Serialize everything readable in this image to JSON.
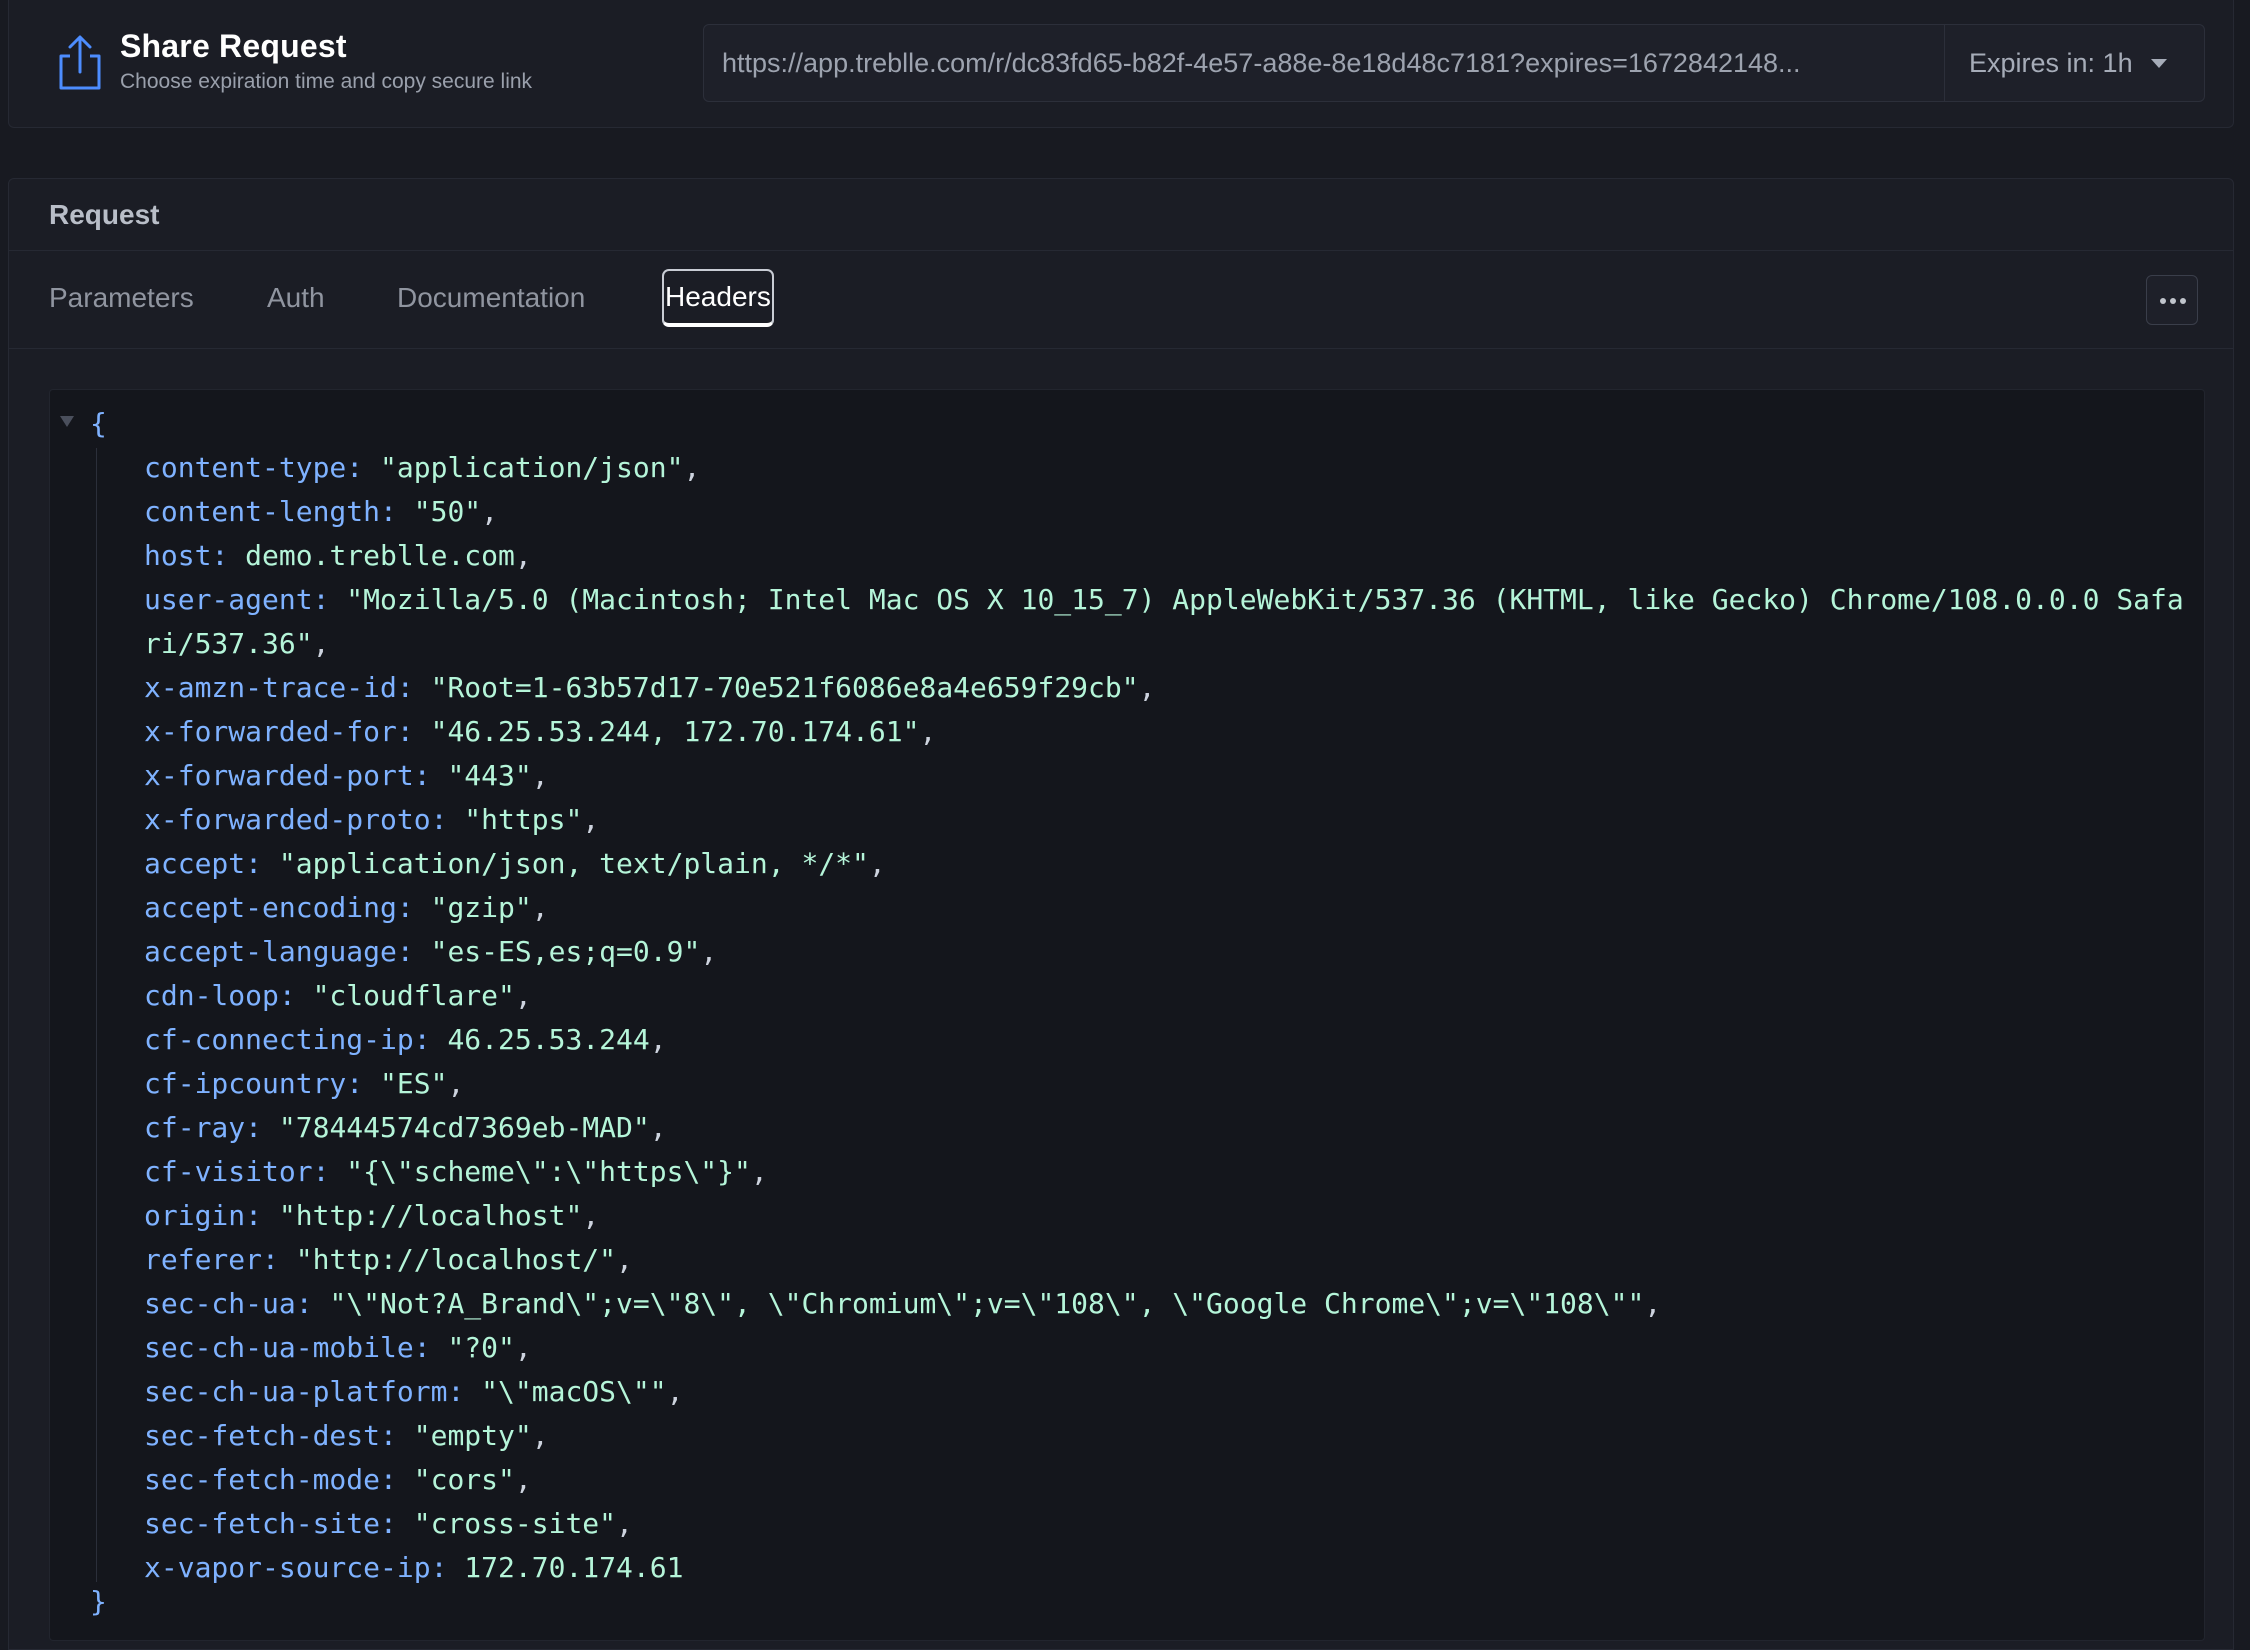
{
  "share": {
    "title": "Share Request",
    "subtitle": "Choose expiration time and copy secure link",
    "url": "https://app.treblle.com/r/dc83fd65-b82f-4e57-a88e-8e18d48c7181?expires=1672842148...",
    "expires_label": "Expires in: 1h",
    "icon": "share-upload-icon"
  },
  "request": {
    "title": "Request",
    "tabs": [
      {
        "label": "Parameters",
        "active": false
      },
      {
        "label": "Auth",
        "active": false
      },
      {
        "label": "Documentation",
        "active": false
      },
      {
        "label": "Headers",
        "active": true
      }
    ],
    "more_icon": "more-horizontal-icon"
  },
  "headers_json": {
    "open_brace": "{",
    "close_brace": "}",
    "entries": [
      {
        "key": "content-type",
        "value": "\"application/json\""
      },
      {
        "key": "content-length",
        "value": "\"50\""
      },
      {
        "key": "host",
        "value": "demo.treblle.com"
      },
      {
        "key": "user-agent",
        "value": "\"Mozilla/5.0 (Macintosh; Intel Mac OS X 10_15_7) AppleWebKit/537.36 (KHTML, like Gecko) Chrome/108.0.0.0 Safari/537.36\""
      },
      {
        "key": "x-amzn-trace-id",
        "value": "\"Root=1-63b57d17-70e521f6086e8a4e659f29cb\""
      },
      {
        "key": "x-forwarded-for",
        "value": "\"46.25.53.244, 172.70.174.61\""
      },
      {
        "key": "x-forwarded-port",
        "value": "\"443\""
      },
      {
        "key": "x-forwarded-proto",
        "value": "\"https\""
      },
      {
        "key": "accept",
        "value": "\"application/json, text/plain, */*\""
      },
      {
        "key": "accept-encoding",
        "value": "\"gzip\""
      },
      {
        "key": "accept-language",
        "value": "\"es-ES,es;q=0.9\""
      },
      {
        "key": "cdn-loop",
        "value": "\"cloudflare\""
      },
      {
        "key": "cf-connecting-ip",
        "value": "46.25.53.244"
      },
      {
        "key": "cf-ipcountry",
        "value": "\"ES\""
      },
      {
        "key": "cf-ray",
        "value": "\"78444574cd7369eb-MAD\""
      },
      {
        "key": "cf-visitor",
        "value": "\"{\\\"scheme\\\":\\\"https\\\"}\""
      },
      {
        "key": "origin",
        "value": "\"http://localhost\""
      },
      {
        "key": "referer",
        "value": "\"http://localhost/\""
      },
      {
        "key": "sec-ch-ua",
        "value": "\"\\\"Not?A_Brand\\\";v=\\\"8\\\", \\\"Chromium\\\";v=\\\"108\\\", \\\"Google Chrome\\\";v=\\\"108\\\"\""
      },
      {
        "key": "sec-ch-ua-mobile",
        "value": "\"?0\""
      },
      {
        "key": "sec-ch-ua-platform",
        "value": "\"\\\"macOS\\\"\""
      },
      {
        "key": "sec-fetch-dest",
        "value": "\"empty\""
      },
      {
        "key": "sec-fetch-mode",
        "value": "\"cors\""
      },
      {
        "key": "sec-fetch-site",
        "value": "\"cross-site\""
      },
      {
        "key": "x-vapor-source-ip",
        "value": "172.70.174.61"
      }
    ]
  },
  "colors": {
    "background": "#181a21",
    "key": "#7fb2ff",
    "value": "#b5f5d9",
    "accent_icon": "#4d8dff"
  }
}
